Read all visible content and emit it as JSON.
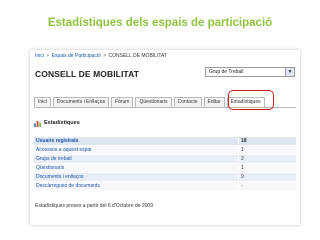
{
  "slide": {
    "title": "Estadístiques dels espais de participació"
  },
  "breadcrumb": {
    "items": [
      "Inici",
      "Espais de Participació",
      "CONSELL DE MOBILITAT"
    ],
    "separator": ">"
  },
  "space": {
    "title": "CONSELL DE MOBILITAT"
  },
  "group_select": {
    "value": "Grup de Treball",
    "icon": "chevron-down-icon"
  },
  "tabs": [
    {
      "label": "Inici",
      "active": false
    },
    {
      "label": "Documents i Enllaços",
      "active": false
    },
    {
      "label": "Fòrum",
      "active": false
    },
    {
      "label": "Qüestionaris",
      "active": false
    },
    {
      "label": "Contacte",
      "active": false
    },
    {
      "label": "Editar",
      "active": false
    },
    {
      "label": "Estadístiques",
      "active": true
    }
  ],
  "highlight_color": "#d11a1a",
  "section": {
    "title": "Estadístiques",
    "icon": "bar-chart-icon"
  },
  "stats": {
    "rows": [
      {
        "label": "Usuaris registrats",
        "value": "18"
      },
      {
        "label": "Accessos a aquest espai",
        "value": "1"
      },
      {
        "label": "Grups de treball",
        "value": "2"
      },
      {
        "label": "Qüestionaris",
        "value": "1"
      },
      {
        "label": "Documents i enllaços",
        "value": "9"
      },
      {
        "label": "Descàrregues de documents",
        "value": "-"
      }
    ],
    "footer": "Estadístiques preses a partir del 6 d'Octubre de 2009"
  },
  "colors": {
    "title_green": "#8fc23f",
    "link_blue": "#1a55a8",
    "row_tint": "#e9eef6"
  }
}
